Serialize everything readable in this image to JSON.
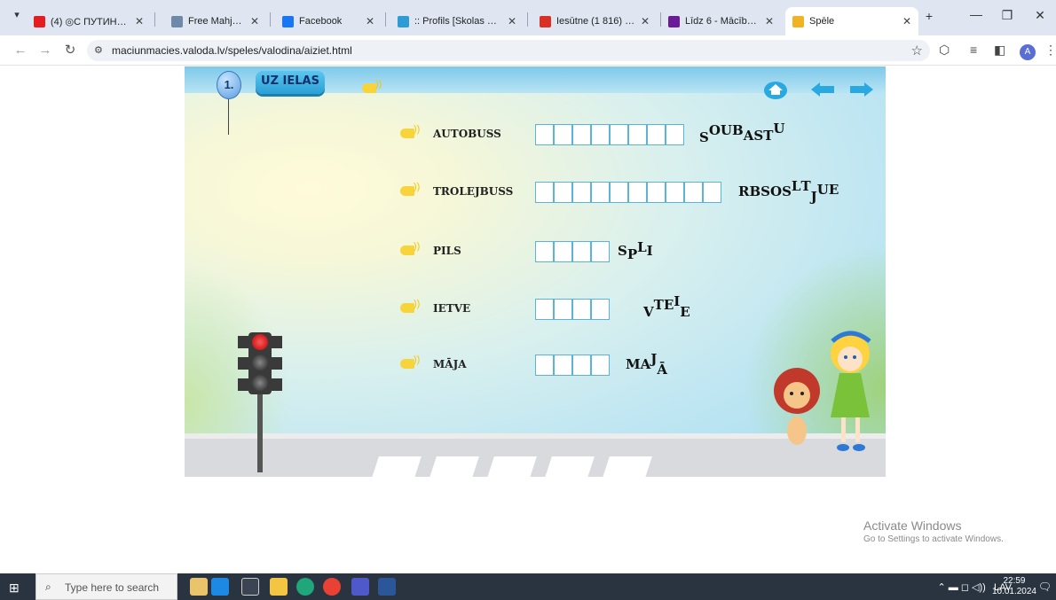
{
  "browser": {
    "tabs": [
      {
        "label": "(4) ◎С ПУТИНЫМ",
        "favicon_color": "#e41e20"
      },
      {
        "label": "Free Mahjong",
        "favicon_color": "#6d8aa8"
      },
      {
        "label": "Facebook",
        "favicon_color": "#1877f2"
      },
      {
        "label": ":: Profils [Skolas adm",
        "favicon_color": "#2c9bd6"
      },
      {
        "label": "Iesūtne (1 816) - ais",
        "favicon_color": "#d93025"
      },
      {
        "label": "Līdz 6 - Mācību mat",
        "favicon_color": "#6a1b9a"
      },
      {
        "label": "Spēle",
        "favicon_color": "#f0b323"
      }
    ],
    "address": "maciunmacies.valoda.lv/speles/valodina/aiziet.html"
  },
  "game": {
    "level_number": "1.",
    "title": "UZ IELAS",
    "words": [
      {
        "word": "AUTOBUSS",
        "boxes": 8,
        "jumble": [
          "S",
          "O",
          "U",
          "B",
          "A",
          "S",
          "T",
          "U"
        ],
        "offsets": [
          4,
          -4,
          -4,
          -4,
          2,
          2,
          2,
          -6
        ]
      },
      {
        "word": "TROLEJBUSS",
        "boxes": 10,
        "jumble": [
          "R",
          "B",
          "S",
          "O",
          "S",
          "L",
          "T",
          "J",
          "U",
          "E"
        ],
        "offsets": [
          0,
          0,
          0,
          0,
          0,
          -6,
          -6,
          6,
          -2,
          -2
        ]
      },
      {
        "word": "PILS",
        "boxes": 4,
        "jumble": [
          "S",
          "P",
          "L",
          "I"
        ],
        "offsets": [
          0,
          4,
          -4,
          0
        ]
      },
      {
        "word": "IETVE",
        "boxes": 4,
        "jumble": [
          "V",
          "T",
          "E",
          "I",
          "E"
        ],
        "offsets": [
          4,
          -4,
          -4,
          -8,
          4
        ]
      },
      {
        "word": "MĀJA",
        "boxes": 4,
        "jumble": [
          "M",
          "A",
          "J",
          "Ā"
        ],
        "offsets": [
          0,
          0,
          -6,
          6
        ]
      }
    ]
  },
  "watermark": {
    "line1": "Activate Windows",
    "line2": "Go to Settings to activate Windows."
  },
  "taskbar": {
    "search_placeholder": "Type here to search",
    "lang": "LAV",
    "time": "22:59",
    "date": "10.01.2024"
  }
}
